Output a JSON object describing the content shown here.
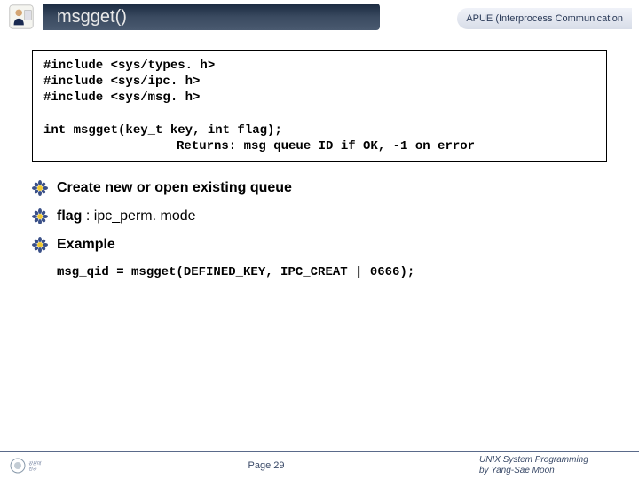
{
  "header": {
    "title": "msgget()",
    "subtitle": "APUE (Interprocess Communication"
  },
  "code_block": {
    "lines": [
      "#include <sys/types. h>",
      "#include <sys/ipc. h>",
      "#include <sys/msg. h>",
      "",
      "int msgget(key_t key, int flag);"
    ],
    "return_line": "Returns: msg queue ID if OK, -1 on error"
  },
  "bullets": [
    {
      "text": "Create new or open existing queue"
    },
    {
      "text_prefix": "flag",
      "text_suffix": " : ipc_perm. mode"
    },
    {
      "text": "Example"
    }
  ],
  "example_code": "msg_qid = msgget(DEFINED_KEY, IPC_CREAT | 0666);",
  "footer": {
    "page": "Page 29",
    "right1": "UNIX System Programming",
    "right2": "by Yang-Sae Moon"
  }
}
